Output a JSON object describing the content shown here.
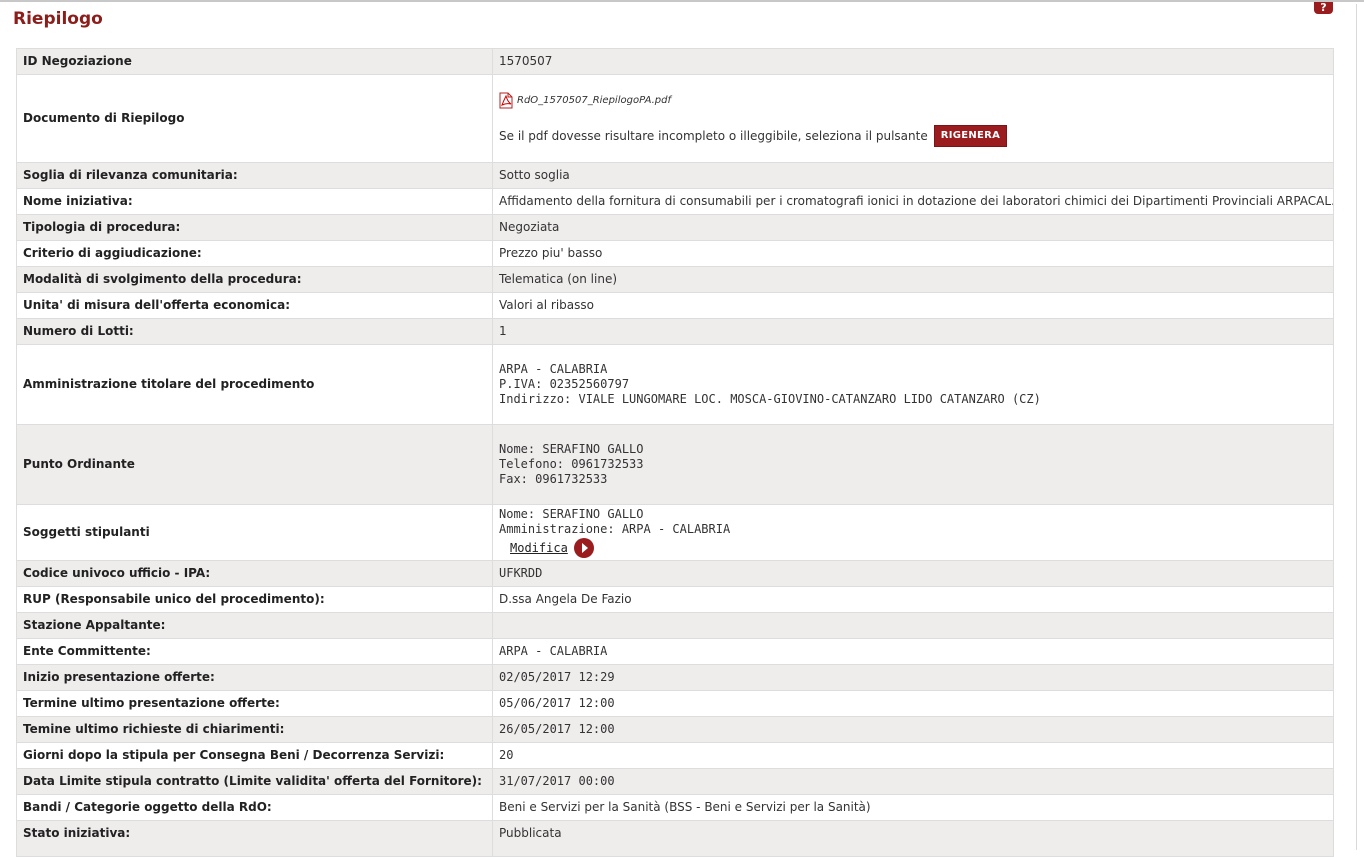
{
  "header": {
    "title": "Riepilogo",
    "help_label": "?"
  },
  "rows": {
    "id_negoziazione": {
      "label": "ID Negoziazione",
      "value": "1570507"
    },
    "documento": {
      "label": "Documento di Riepilogo",
      "file_name": "RdO_1570507_RiepilogoPA.pdf",
      "note": "Se il pdf dovesse risultare incompleto o illeggibile, seleziona il pulsante",
      "button": "RIGENERA",
      "icon": "pdf-icon"
    },
    "soglia": {
      "label": "Soglia di rilevanza comunitaria:",
      "value": "Sotto soglia"
    },
    "nome": {
      "label": "Nome iniziativa:",
      "value": "Affidamento della fornitura di consumabili per i cromatografi ionici in dotazione dei laboratori chimici dei Dipartimenti Provinciali ARPACAL."
    },
    "tipologia": {
      "label": "Tipologia di procedura:",
      "value": "Negoziata"
    },
    "criterio": {
      "label": "Criterio di aggiudicazione:",
      "value": "Prezzo piu' basso"
    },
    "modalita": {
      "label": "Modalità di svolgimento della procedura:",
      "value": "Telematica (on line)"
    },
    "unita": {
      "label": "Unita' di misura dell'offerta economica:",
      "value": "Valori al ribasso"
    },
    "lotti": {
      "label": "Numero di Lotti:",
      "value": "1"
    },
    "amministrazione": {
      "label": "Amministrazione titolare del procedimento",
      "line1": "ARPA - CALABRIA",
      "line2": "P.IVA: 02352560797",
      "line3": "Indirizzo: VIALE LUNGOMARE LOC. MOSCA-GIOVINO-CATANZARO LIDO CATANZARO (CZ)"
    },
    "punto_ordinante": {
      "label": "Punto Ordinante",
      "line1": "Nome: SERAFINO GALLO",
      "line2": "Telefono: 0961732533",
      "line3": "Fax: 0961732533"
    },
    "soggetti": {
      "label": "Soggetti stipulanti",
      "line1": "Nome: SERAFINO GALLO",
      "line2": "Amministrazione: ARPA - CALABRIA",
      "link": "Modifica",
      "icon": "arrow-right-icon"
    },
    "ipa": {
      "label": "Codice univoco ufficio - IPA:",
      "value": "UFKRDD"
    },
    "rup": {
      "label": "RUP (Responsabile unico del procedimento):",
      "value": "D.ssa Angela De Fazio"
    },
    "stazione": {
      "label": "Stazione Appaltante:",
      "value": ""
    },
    "ente": {
      "label": "Ente Committente:",
      "value": "ARPA - CALABRIA"
    },
    "inizio": {
      "label": "Inizio presentazione offerte:",
      "value": "02/05/2017 12:29"
    },
    "termine": {
      "label": "Termine ultimo presentazione offerte:",
      "value": "05/06/2017 12:00"
    },
    "chiarimenti": {
      "label": "Temine ultimo richieste di chiarimenti:",
      "value": "26/05/2017 12:00"
    },
    "giorni": {
      "label": "Giorni dopo la stipula per Consegna Beni / Decorrenza Servizi:",
      "value": "20"
    },
    "data_limite": {
      "label": "Data Limite stipula contratto (Limite validita' offerta del Fornitore):",
      "value": "31/07/2017 00:00"
    },
    "bandi": {
      "label": "Bandi / Categorie oggetto della RdO:",
      "value": "Beni e Servizi per la Sanità (BSS - Beni e Servizi per la Sanità)"
    },
    "stato": {
      "label": "Stato iniziativa:",
      "value": "Pubblicata"
    }
  },
  "colors": {
    "accent": "#9b1c1f",
    "title": "#8b1d1a",
    "row_alt": "#efecec"
  }
}
